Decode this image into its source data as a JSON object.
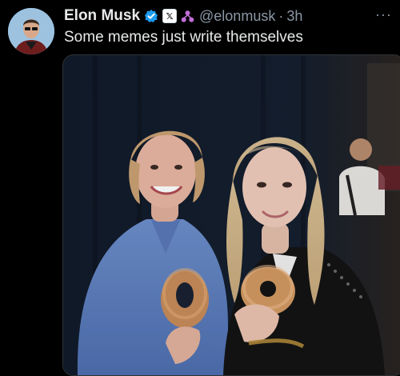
{
  "post": {
    "author_name": "Elon Musk",
    "handle": "@elonmusk",
    "separator": "·",
    "time": "3h",
    "text": "Some memes just write themselves",
    "more": "···",
    "x_badge": "𝕏"
  },
  "icons": {
    "verified": "verified-badge-icon",
    "x_logo": "x-logo-icon",
    "affiliate": "affiliate-icon",
    "more": "more-options-icon"
  },
  "colors": {
    "background": "#000000",
    "primary_text": "#e7e9ea",
    "secondary_text": "#8b98a5",
    "verified_blue": "#1d9bf0",
    "affiliate_purple": "#c26ed8"
  }
}
